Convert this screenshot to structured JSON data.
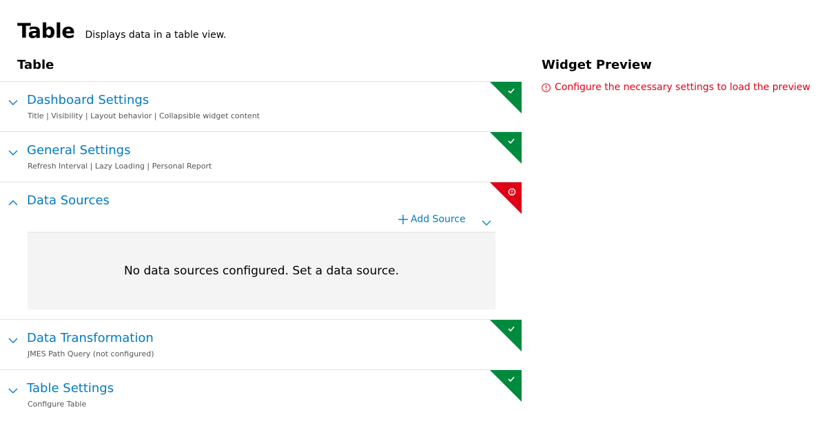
{
  "page": {
    "title": "Table",
    "description": "Displays data in a table view."
  },
  "left_heading": "Table",
  "preview": {
    "heading": "Widget Preview",
    "message": "Configure the necessary settings to load the preview",
    "message_color": "#e00015"
  },
  "colors": {
    "accent": "#007bc0",
    "success": "#008a3e",
    "error": "#e00015",
    "empty_bg": "#f4f4f4"
  },
  "sections": [
    {
      "label": "Dashboard Settings",
      "subtitle": "Title | Visibility | Layout behavior | Collapsible widget content",
      "status": "success",
      "icon": "checkmark-icon",
      "expanded": false
    },
    {
      "label": "General Settings",
      "subtitle": "Refresh Interval | Lazy Loading | Personal Report",
      "status": "success",
      "icon": "checkmark-icon",
      "expanded": false
    },
    {
      "label": "Data Sources",
      "subtitle": "",
      "status": "error",
      "icon": "alert-icon",
      "expanded": true,
      "add_source_label": "Add Source",
      "empty_message": "No data sources configured. Set a data source."
    },
    {
      "label": "Data Transformation",
      "subtitle": "JMES Path Query (not configured)",
      "status": "success",
      "icon": "checkmark-icon",
      "expanded": false
    },
    {
      "label": "Table Settings",
      "subtitle": "Configure Table",
      "status": "success",
      "icon": "checkmark-icon",
      "expanded": false
    }
  ]
}
